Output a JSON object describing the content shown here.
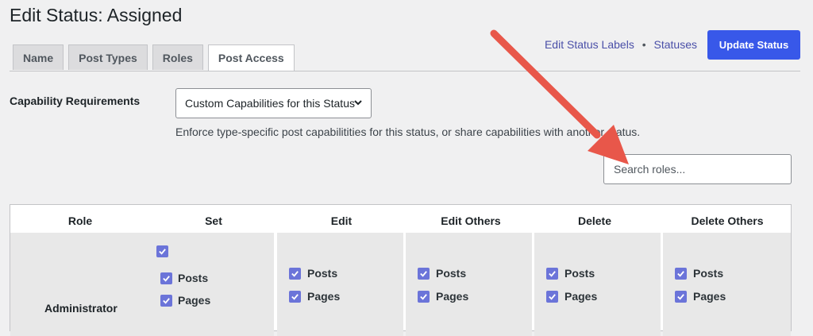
{
  "page": {
    "title": "Edit Status: Assigned"
  },
  "tabs": [
    {
      "label": "Name"
    },
    {
      "label": "Post Types"
    },
    {
      "label": "Roles"
    },
    {
      "label": "Post Access",
      "active": true
    }
  ],
  "top_links": {
    "edit_labels": "Edit Status Labels",
    "separator": "•",
    "statuses": "Statuses"
  },
  "update_button": {
    "label": "Update Status"
  },
  "capability": {
    "label": "Capability Requirements",
    "selected": "Custom Capabilities for this Status",
    "description": "Enforce type-specific post capabilitities for this status, or share capabilities with another status."
  },
  "search": {
    "placeholder": "Search roles..."
  },
  "table": {
    "headers": [
      "Role",
      "Set",
      "Edit",
      "Edit Others",
      "Delete",
      "Delete Others"
    ],
    "rows": [
      {
        "role": "Administrator",
        "set": {
          "all": true,
          "posts": "Posts",
          "pages": "Pages"
        },
        "edit": {
          "posts": "Posts",
          "pages": "Pages"
        },
        "edit_others": {
          "posts": "Posts",
          "pages": "Pages"
        },
        "delete": {
          "posts": "Posts",
          "pages": "Pages"
        },
        "delete_others": {
          "posts": "Posts",
          "pages": "Pages"
        }
      }
    ]
  },
  "colors": {
    "accent": "#3858e9",
    "checkbox": "#6b74d9",
    "annotation_arrow": "#e8574a"
  },
  "icons": {
    "checkbox": "check-icon",
    "select": "chevron-down-icon",
    "annotation": "arrow-icon"
  }
}
